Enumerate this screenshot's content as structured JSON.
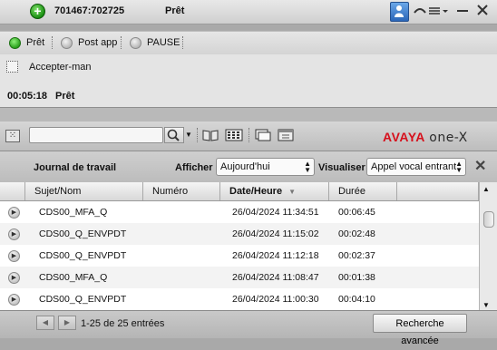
{
  "call": {
    "number": "701467:702725",
    "state": "Prêt"
  },
  "agent_states": {
    "ready": "Prêt",
    "post_call": "Post app",
    "pause": "PAUSE"
  },
  "info": {
    "auto_accept_label": "Accepter-man",
    "timer": "00:05:18",
    "timer_state": "Prêt"
  },
  "toolbar": {
    "search_placeholder": "",
    "brand_avaya": "AVAYA",
    "brand_onex": "one-X"
  },
  "work_log": {
    "title": "Journal de travail",
    "show_label": "Afficher :",
    "show_value": "Aujourd'hui",
    "view_label": "Visualiser :",
    "view_value": "Appel vocal entrant",
    "columns": [
      "Sujet/Nom",
      "Numéro",
      "Date/Heure",
      "Durée"
    ],
    "rows": [
      {
        "subject": "CDS00_MFA_Q",
        "number": "",
        "date": "26/04/2024 11:34:51",
        "duration": "00:06:45"
      },
      {
        "subject": "CDS00_Q_ENVPDT",
        "number": "",
        "date": "26/04/2024 11:15:02",
        "duration": "00:02:48"
      },
      {
        "subject": "CDS00_Q_ENVPDT",
        "number": "",
        "date": "26/04/2024 11:12:18",
        "duration": "00:02:37"
      },
      {
        "subject": "CDS00_MFA_Q",
        "number": "",
        "date": "26/04/2024 11:08:47",
        "duration": "00:01:38"
      },
      {
        "subject": "CDS00_Q_ENVPDT",
        "number": "",
        "date": "26/04/2024 11:00:30",
        "duration": "00:04:10"
      }
    ]
  },
  "footer": {
    "page_info": "1-25 de 25 entrées",
    "advanced_search": "Recherche avancée"
  },
  "colors": {
    "brand_red": "#d6101c",
    "ready_green": "#2aa11c"
  }
}
